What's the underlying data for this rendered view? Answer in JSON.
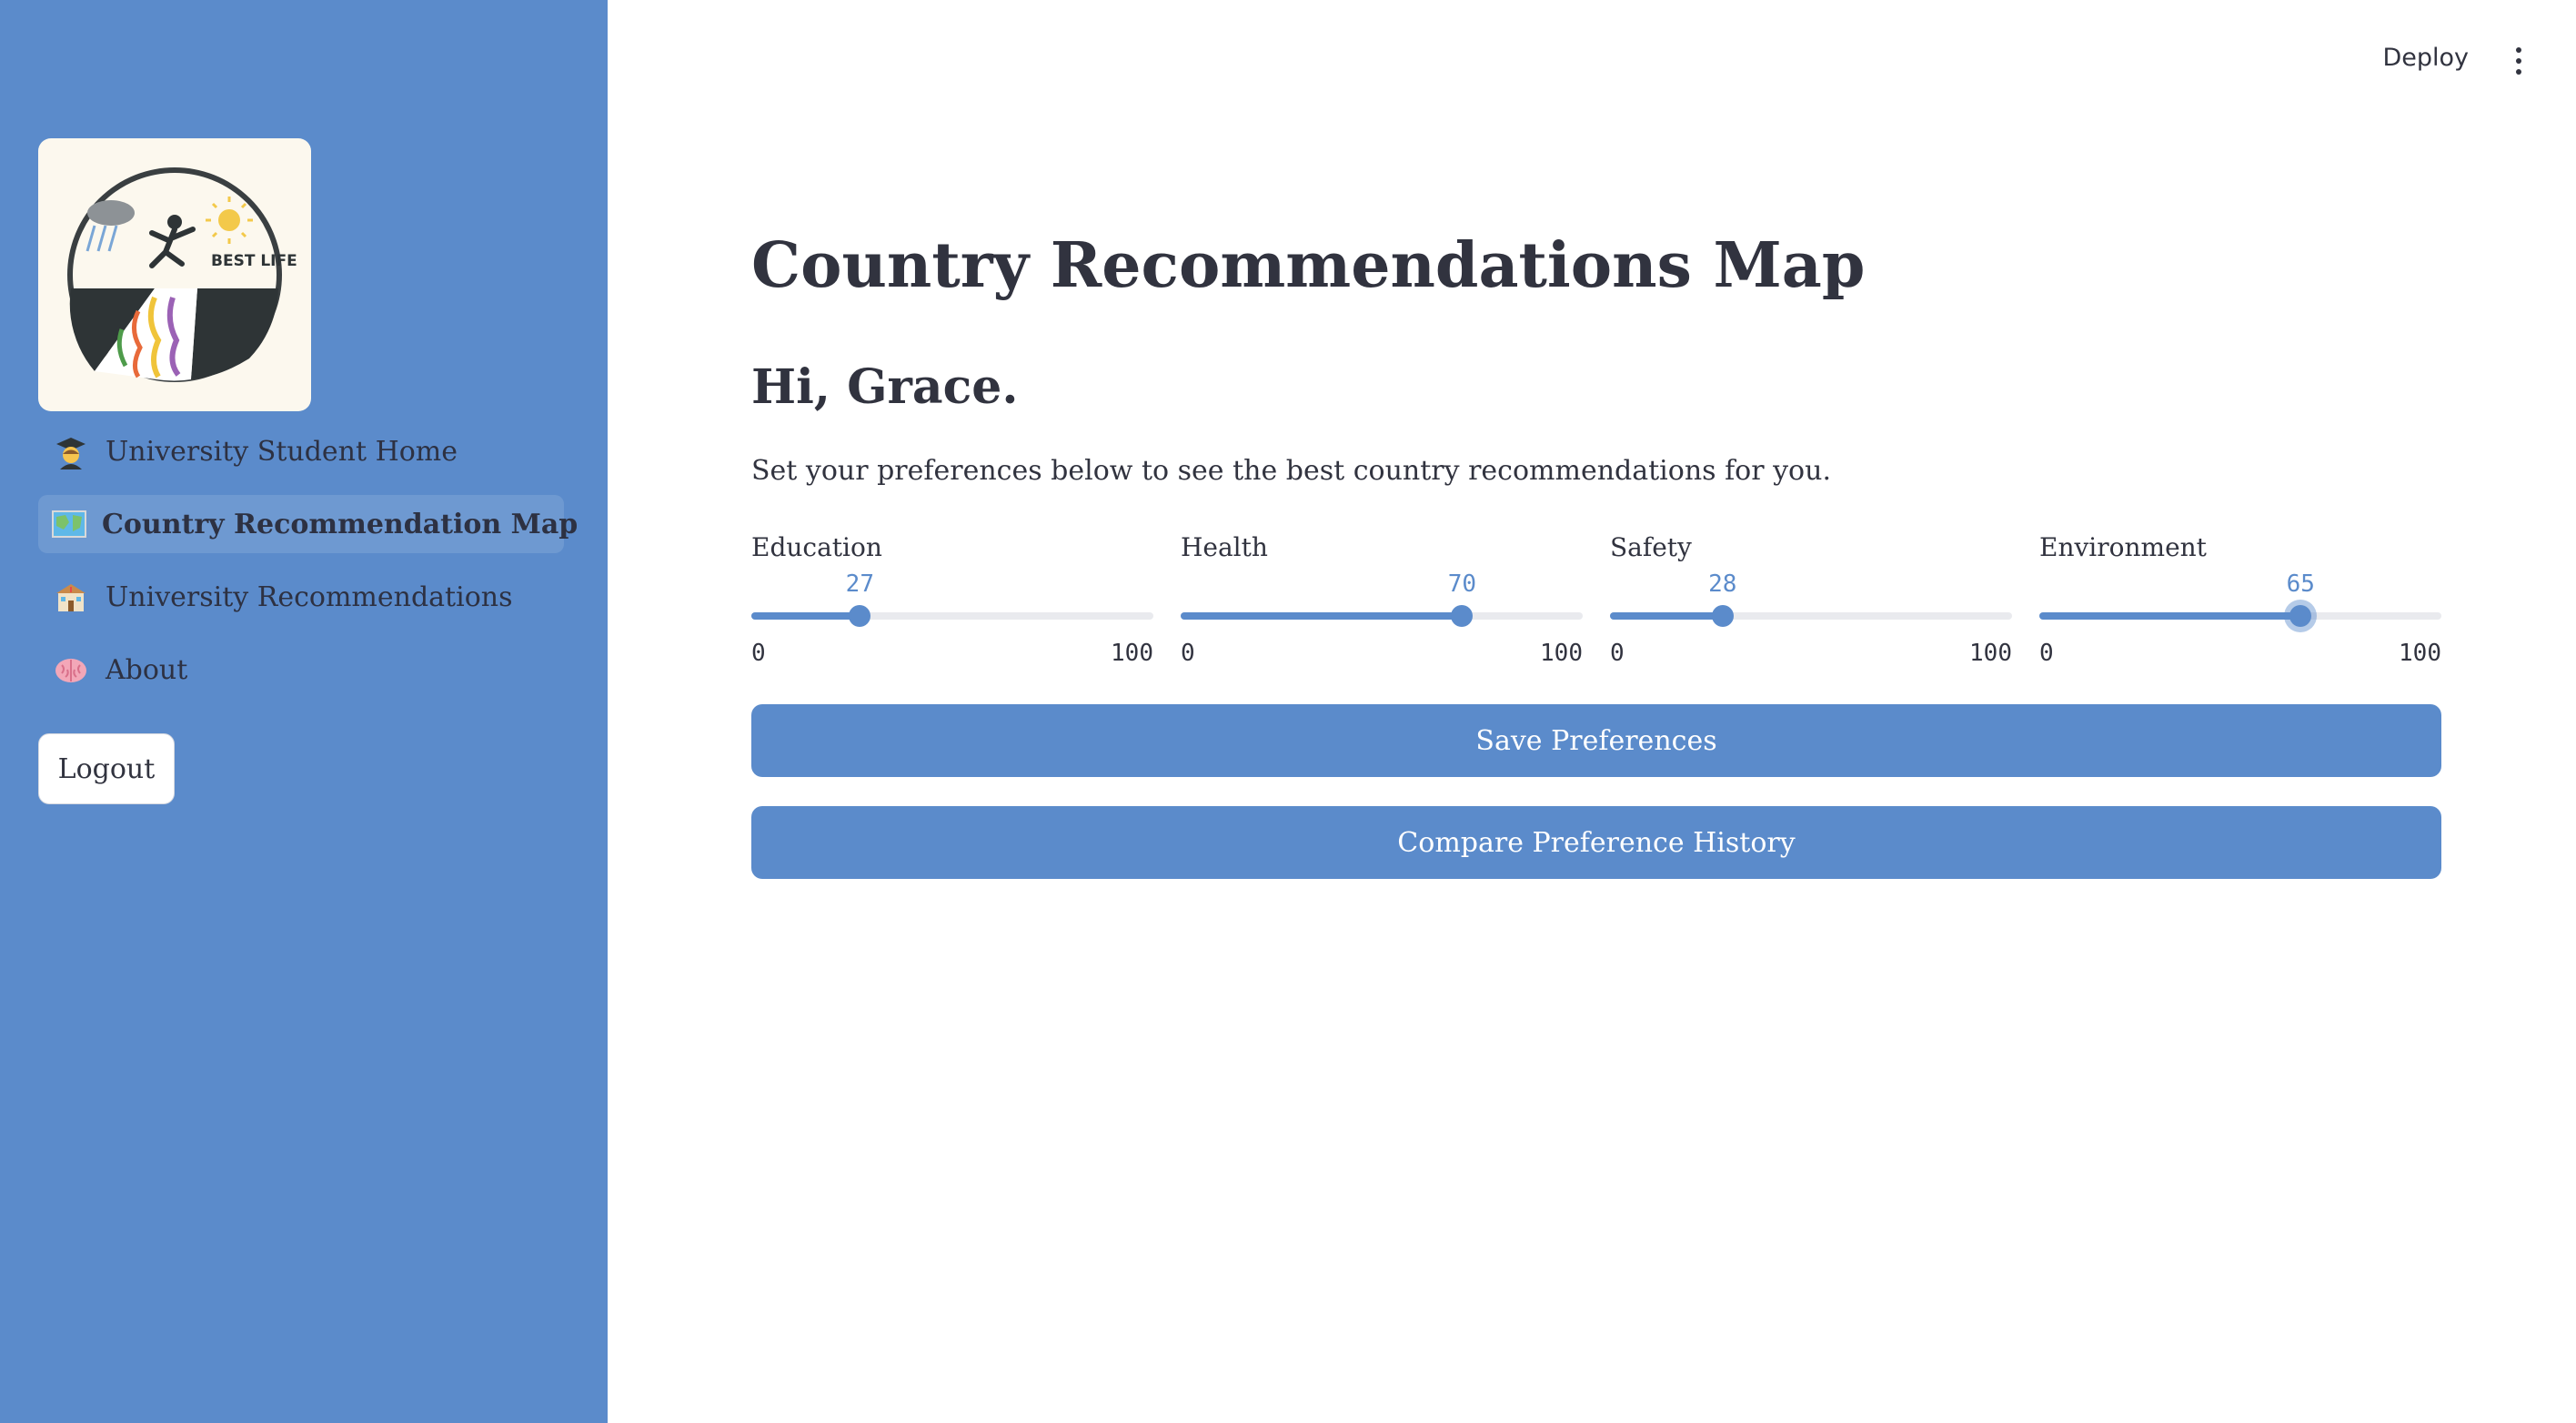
{
  "header": {
    "deploy_label": "Deploy",
    "menu_icon": "kebab-menu-icon"
  },
  "sidebar": {
    "logo_text": "BEST LIFE",
    "items": [
      {
        "label": "University Student Home",
        "icon": "student-emoji-icon",
        "active": false
      },
      {
        "label": "Country Recommendation Map",
        "icon": "map-emoji-icon",
        "active": true
      },
      {
        "label": "University Recommendations",
        "icon": "school-emoji-icon",
        "active": false
      },
      {
        "label": "About",
        "icon": "brain-emoji-icon",
        "active": false
      }
    ],
    "logout_label": "Logout"
  },
  "main": {
    "title": "Country Recommendations Map",
    "greeting": "Hi, Grace.",
    "description": "Set your preferences below to see the best country recommendations for you.",
    "sliders": [
      {
        "label": "Education",
        "value": "27",
        "min": "0",
        "max": "100"
      },
      {
        "label": "Health",
        "value": "70",
        "min": "0",
        "max": "100"
      },
      {
        "label": "Safety",
        "value": "28",
        "min": "0",
        "max": "100"
      },
      {
        "label": "Environment",
        "value": "65",
        "min": "0",
        "max": "100",
        "focused": true
      }
    ],
    "save_label": "Save Preferences",
    "compare_label": "Compare Preference History"
  },
  "colors": {
    "accent": "#5b8bcb",
    "sidebar_bg": "#5b8bcb",
    "text": "#31333f"
  }
}
